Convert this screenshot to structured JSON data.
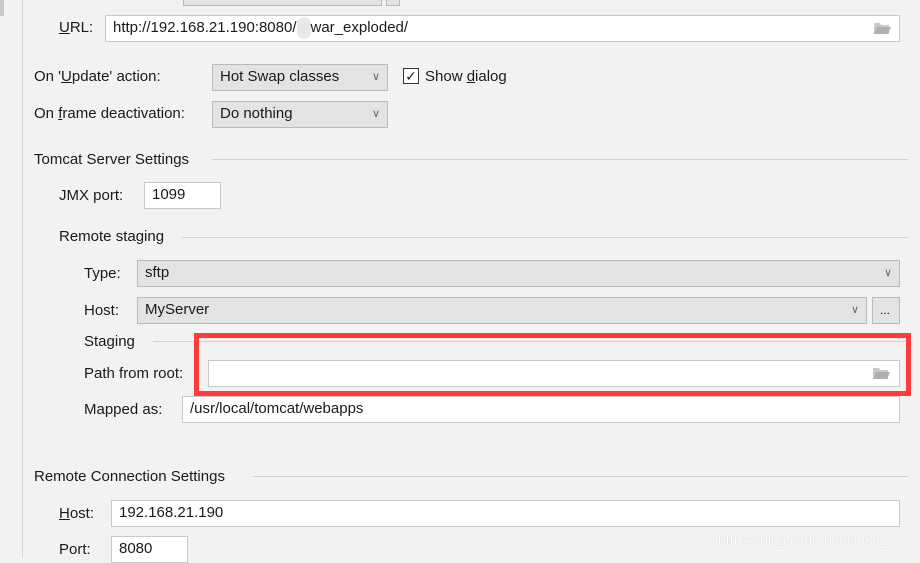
{
  "url": {
    "label_prefix": "",
    "label_ul": "U",
    "label_rest": "RL:",
    "value": "http://192.168.21.190:8080/",
    "value_suffix": "war_exploded/"
  },
  "update_action": {
    "label_a": "On '",
    "label_ul": "U",
    "label_b": "pdate' action:",
    "value": "Hot Swap classes"
  },
  "show_dialog": {
    "label_a": "Show ",
    "label_ul": "d",
    "label_b": "ialog",
    "checked": true
  },
  "frame_deactivation": {
    "label_a": "On ",
    "label_ul": "f",
    "label_b": "rame deactivation:",
    "value": "Do nothing"
  },
  "tomcat": {
    "title": "Tomcat Server Settings",
    "jmx_label": "JMX port:",
    "jmx_value": "1099",
    "remote_staging": {
      "title": "Remote staging",
      "type_label": "Type:",
      "type_value": "sftp",
      "host_label": "Host:",
      "host_value": "MyServer",
      "host_more": "...",
      "staging_title": "Staging",
      "path_label": "Path from root:",
      "path_value": "",
      "mapped_label": "Mapped as:",
      "mapped_value": "/usr/local/tomcat/webapps"
    }
  },
  "remote_connection": {
    "title": "Remote Connection Settings",
    "host_label_ul": "H",
    "host_label_rest": "ost:",
    "host_value": "192.168.21.190",
    "port_label": "Port:",
    "port_value": "8080"
  },
  "watermark": "https://blog.csdn.net/sinse_",
  "colors": {
    "highlight": "#ff3b3b",
    "background": "#f2f2f2"
  }
}
